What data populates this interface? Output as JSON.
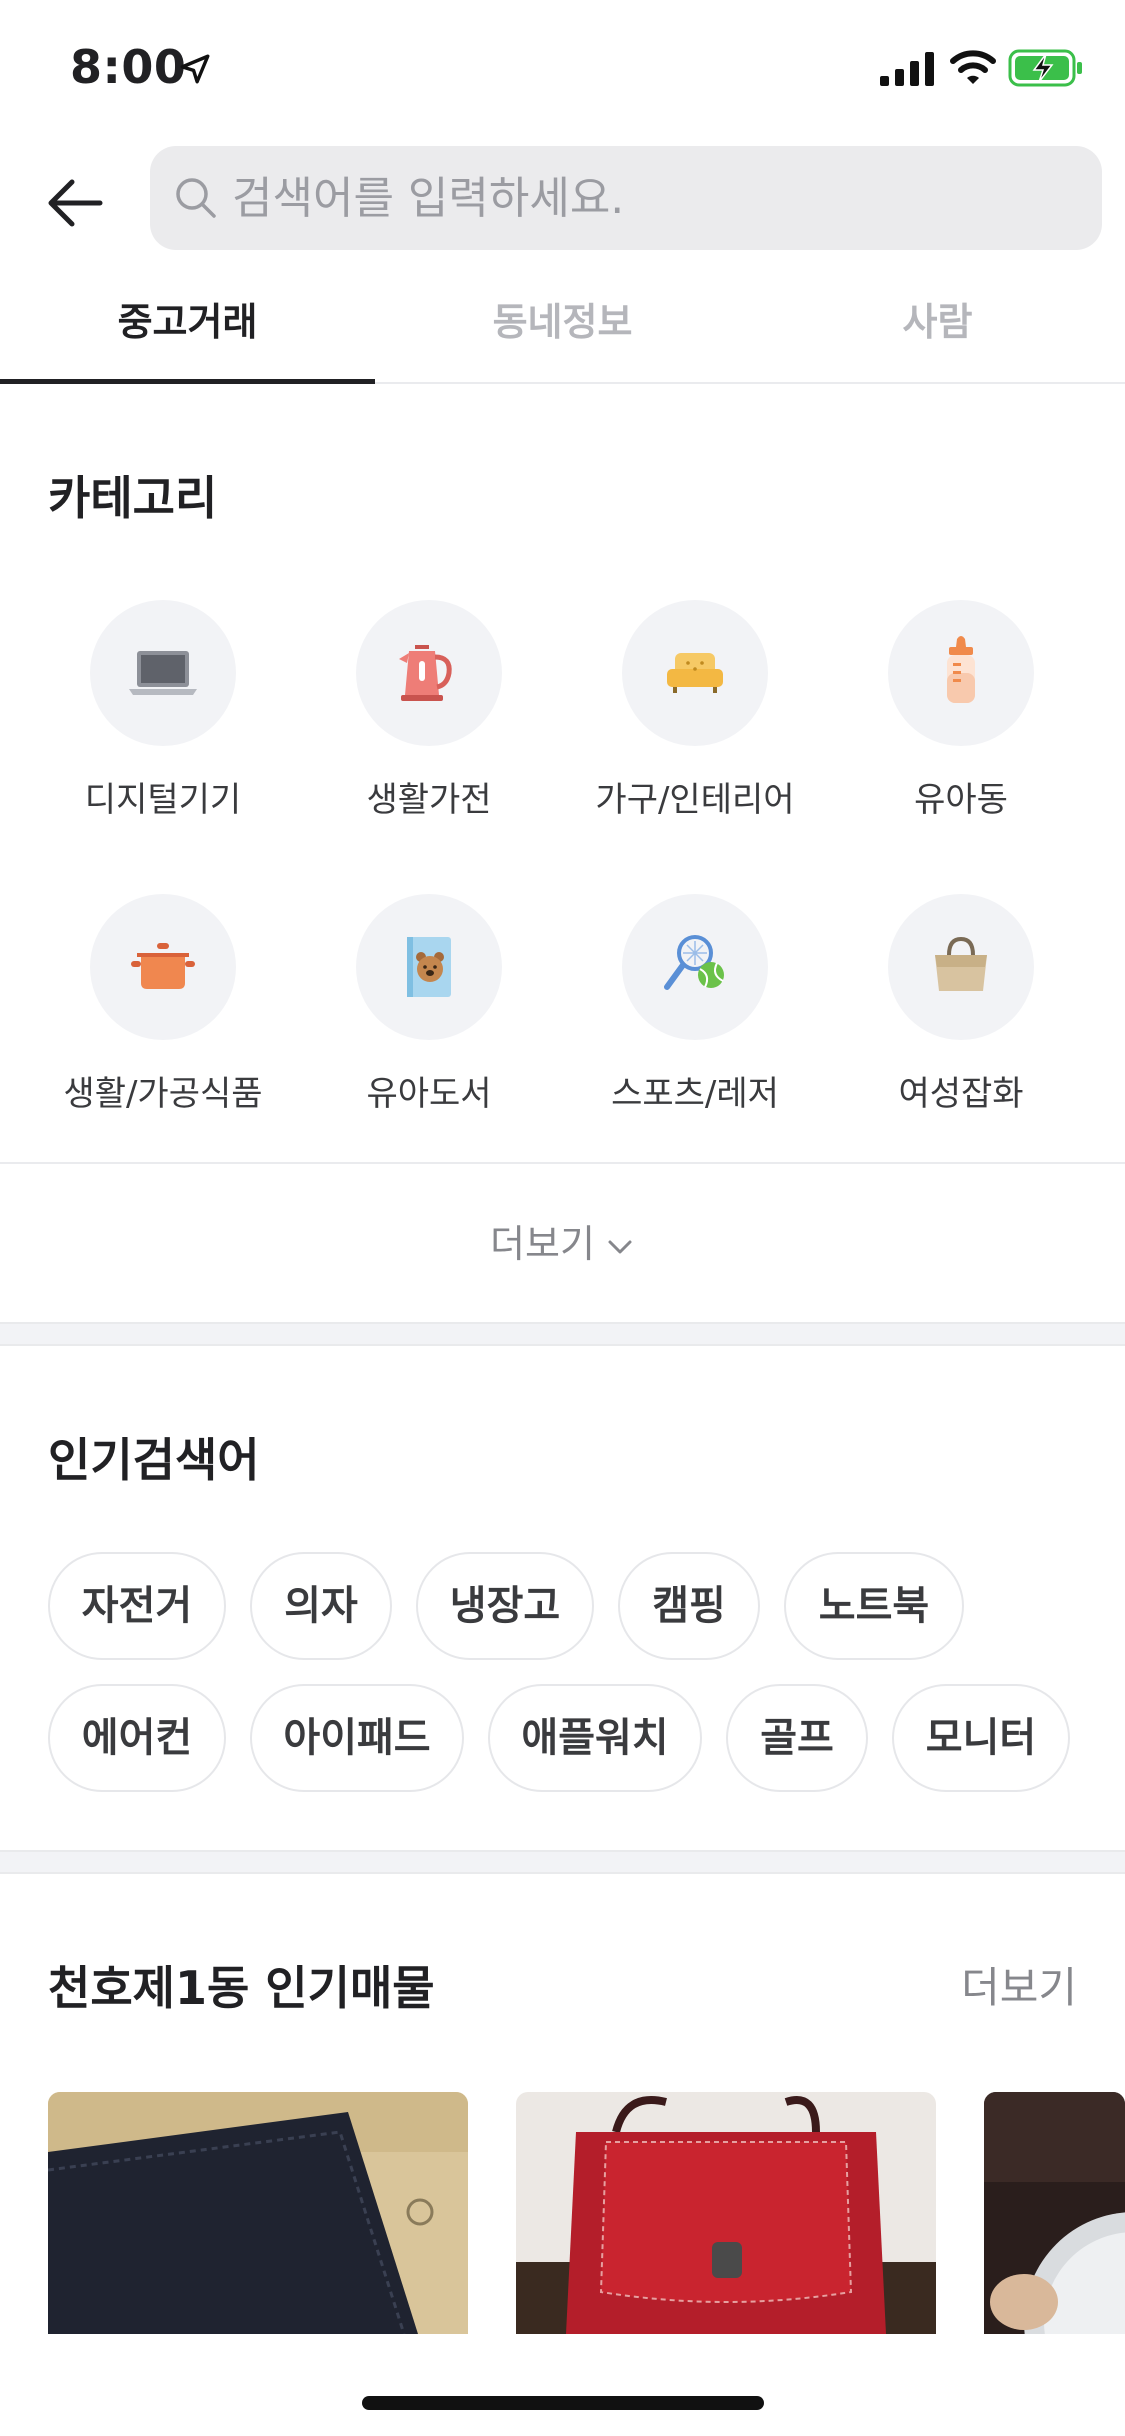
{
  "status_bar": {
    "time": "8:00",
    "battery_color": "#3bbf4a"
  },
  "search": {
    "placeholder": "검색어를 입력하세요."
  },
  "tabs": [
    {
      "label": "중고거래",
      "active": true
    },
    {
      "label": "동네정보",
      "active": false
    },
    {
      "label": "사람",
      "active": false
    }
  ],
  "category": {
    "title": "카테고리",
    "items": [
      {
        "label": "디지털기기",
        "icon": "laptop-icon"
      },
      {
        "label": "생활가전",
        "icon": "kettle-icon"
      },
      {
        "label": "가구/인테리어",
        "icon": "sofa-icon"
      },
      {
        "label": "유아동",
        "icon": "baby-bottle-icon"
      },
      {
        "label": "생활/가공식품",
        "icon": "pot-icon"
      },
      {
        "label": "유아도서",
        "icon": "bear-book-icon"
      },
      {
        "label": "스포츠/레저",
        "icon": "tennis-icon"
      },
      {
        "label": "여성잡화",
        "icon": "handbag-icon"
      }
    ],
    "more_label": "더보기"
  },
  "popular_search": {
    "title": "인기검색어",
    "keywords": [
      "자전거",
      "의자",
      "냉장고",
      "캠핑",
      "노트북",
      "에어컨",
      "아이패드",
      "애플워치",
      "골프",
      "모니터"
    ]
  },
  "popular_items": {
    "title": "천호제1동 인기매물",
    "more_label": "더보기"
  },
  "colors": {
    "accent": "#212124",
    "muted": "#b5b6bb",
    "chip_border": "#e6e7ea"
  }
}
